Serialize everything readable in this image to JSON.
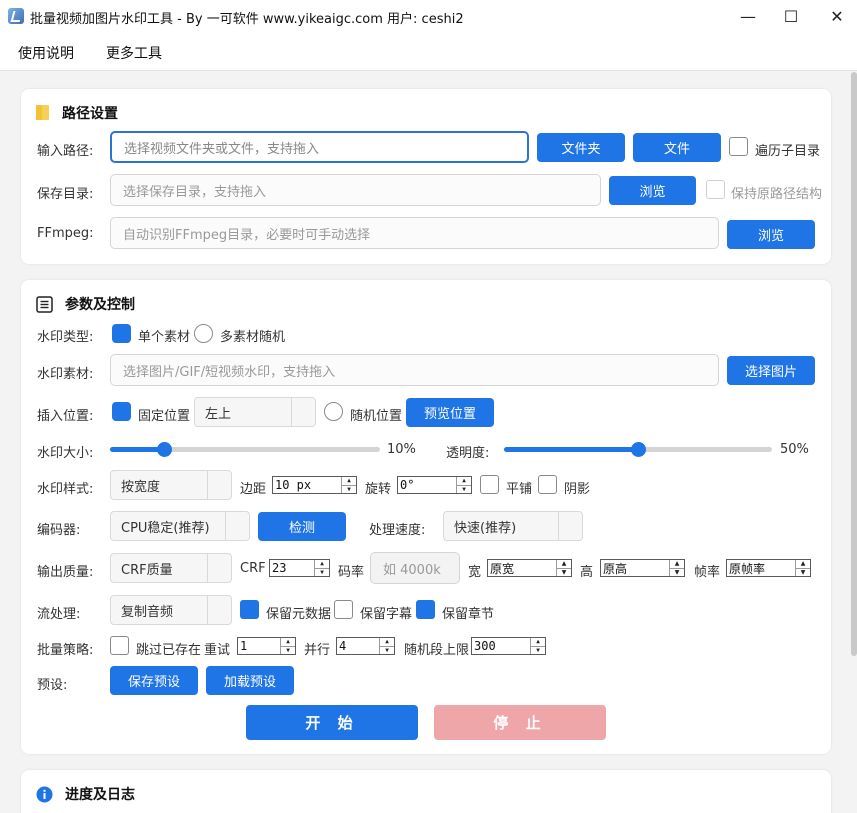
{
  "window": {
    "title": "批量视频加图片水印工具 - By 一可软件 www.yikeaigc.com 用户: ceshi2",
    "minimize": "—",
    "maximize": "☐",
    "close": "✕"
  },
  "menu": [
    "使用说明",
    "更多工具"
  ],
  "path_section": {
    "title": "路径设置",
    "input_label": "输入路径:",
    "input_placeholder": "选择视频文件夹或文件，支持拖入",
    "folder_button": "文件夹",
    "file_button": "文件",
    "recursive_label": "遍历子目录",
    "save_label": "保存目录:",
    "save_placeholder": "选择保存目录，支持拖入",
    "browse_button": "浏览",
    "keep_structure_label": "保持原路径结构",
    "ffmpeg_label": "FFmpeg:",
    "ffmpeg_placeholder": "自动识别FFmpeg目录，必要时可手动选择",
    "ffmpeg_browse_button": "浏览"
  },
  "params_section": {
    "title": "参数及控制",
    "wm_type_label": "水印类型:",
    "single_label": "单个素材",
    "multi_label": "多素材随机",
    "wm_source_label": "水印素材:",
    "wm_source_placeholder": "选择图片/GIF/短视频水印，支持拖入",
    "choose_image_button": "选择图片",
    "position_label": "插入位置:",
    "fixed_label": "固定位置",
    "fixed_value": "左上",
    "random_pos_label": "随机位置",
    "preview_button": "预览位置",
    "size_label": "水印大小:",
    "size_value": 10,
    "size_text": "10%",
    "opacity_label": "透明度:",
    "opacity_value": 50,
    "opacity_text": "50%",
    "style_label": "水印样式:",
    "style_value": "按宽度",
    "margin_label": "边距",
    "margin_value": "10 px",
    "rotate_label": "旋转",
    "rotate_value": "0°",
    "tile_label": "平铺",
    "shadow_label": "阴影",
    "codec_label": "编码器:",
    "codec_value": "CPU稳定(推荐)",
    "detect_button": "检测",
    "speed_label": "处理速度:",
    "speed_value": "快速(推荐)",
    "quality_label": "输出质量:",
    "quality_value": "CRF质量",
    "crf_label": "CRF",
    "crf_value": "23",
    "bitrate_label": "码率",
    "bitrate_placeholder": "如 4000k",
    "width_label": "宽",
    "width_value": "原宽",
    "height_label": "高",
    "height_value": "原高",
    "fps_label": "帧率",
    "fps_value": "原帧率",
    "stream_label": "流处理:",
    "stream_value": "复制音频",
    "keep_meta_label": "保留元数据",
    "keep_sub_label": "保留字幕",
    "keep_chapter_label": "保留章节",
    "batch_label": "批量策略:",
    "skip_label": "跳过已存在",
    "retry_label": "重试",
    "retry_value": "1",
    "parallel_label": "并行",
    "parallel_value": "4",
    "rand_limit_label": "随机段上限",
    "rand_limit_value": "300",
    "preset_label": "预设:",
    "save_preset_button": "保存预设",
    "load_preset_button": "加载预设",
    "start_button": "开 始",
    "stop_button": "停 止"
  },
  "log_section": {
    "title": "进度及日志"
  },
  "colors": {
    "accent": "#1f74e6",
    "stop_disabled": "#eea6a8",
    "folder_icon": "#f6cf57"
  }
}
